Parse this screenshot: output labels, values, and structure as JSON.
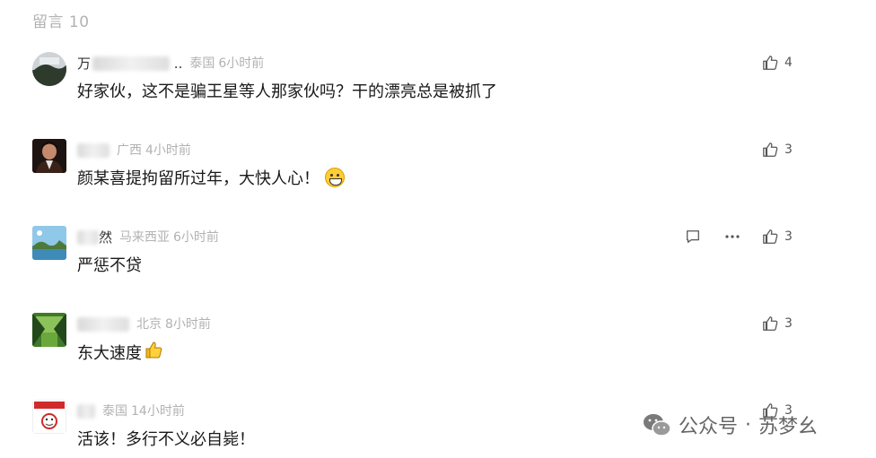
{
  "header": {
    "title": "留言 10"
  },
  "comments": [
    {
      "nick": "万",
      "nick_tail": "..",
      "region": "泰国",
      "time": "6小时前",
      "text": "好家伙，这不是骗王星等人那家伙吗？干的漂亮总是被抓了",
      "likes": "4"
    },
    {
      "nick": "",
      "nick_tail": "",
      "region": "广西",
      "time": "4小时前",
      "text": "颜某喜提拘留所过年，大快人心！",
      "likes": "3"
    },
    {
      "nick": "然",
      "nick_tail": "",
      "region": "马来西亚",
      "time": "6小时前",
      "text": "严惩不贷",
      "likes": "3"
    },
    {
      "nick": "",
      "nick_tail": "",
      "region": "北京",
      "time": "8小时前",
      "text": "东大速度",
      "likes": "3"
    },
    {
      "nick": "",
      "nick_tail": "",
      "region": "泰国",
      "time": "14小时前",
      "text": "活该！多行不义必自毙！",
      "likes": "3"
    }
  ],
  "icons": {
    "like": "thumbs-up-icon",
    "reply": "comment-bubble-icon",
    "more": "more-dots-icon",
    "grin": "grinning-emoji",
    "thumb": "thumbs-up-emoji"
  },
  "watermark": {
    "left": "公众号",
    "sep": "·",
    "right": "苏梦幺"
  },
  "colors": {
    "muted": "#b2b2b2",
    "text": "#191919"
  }
}
